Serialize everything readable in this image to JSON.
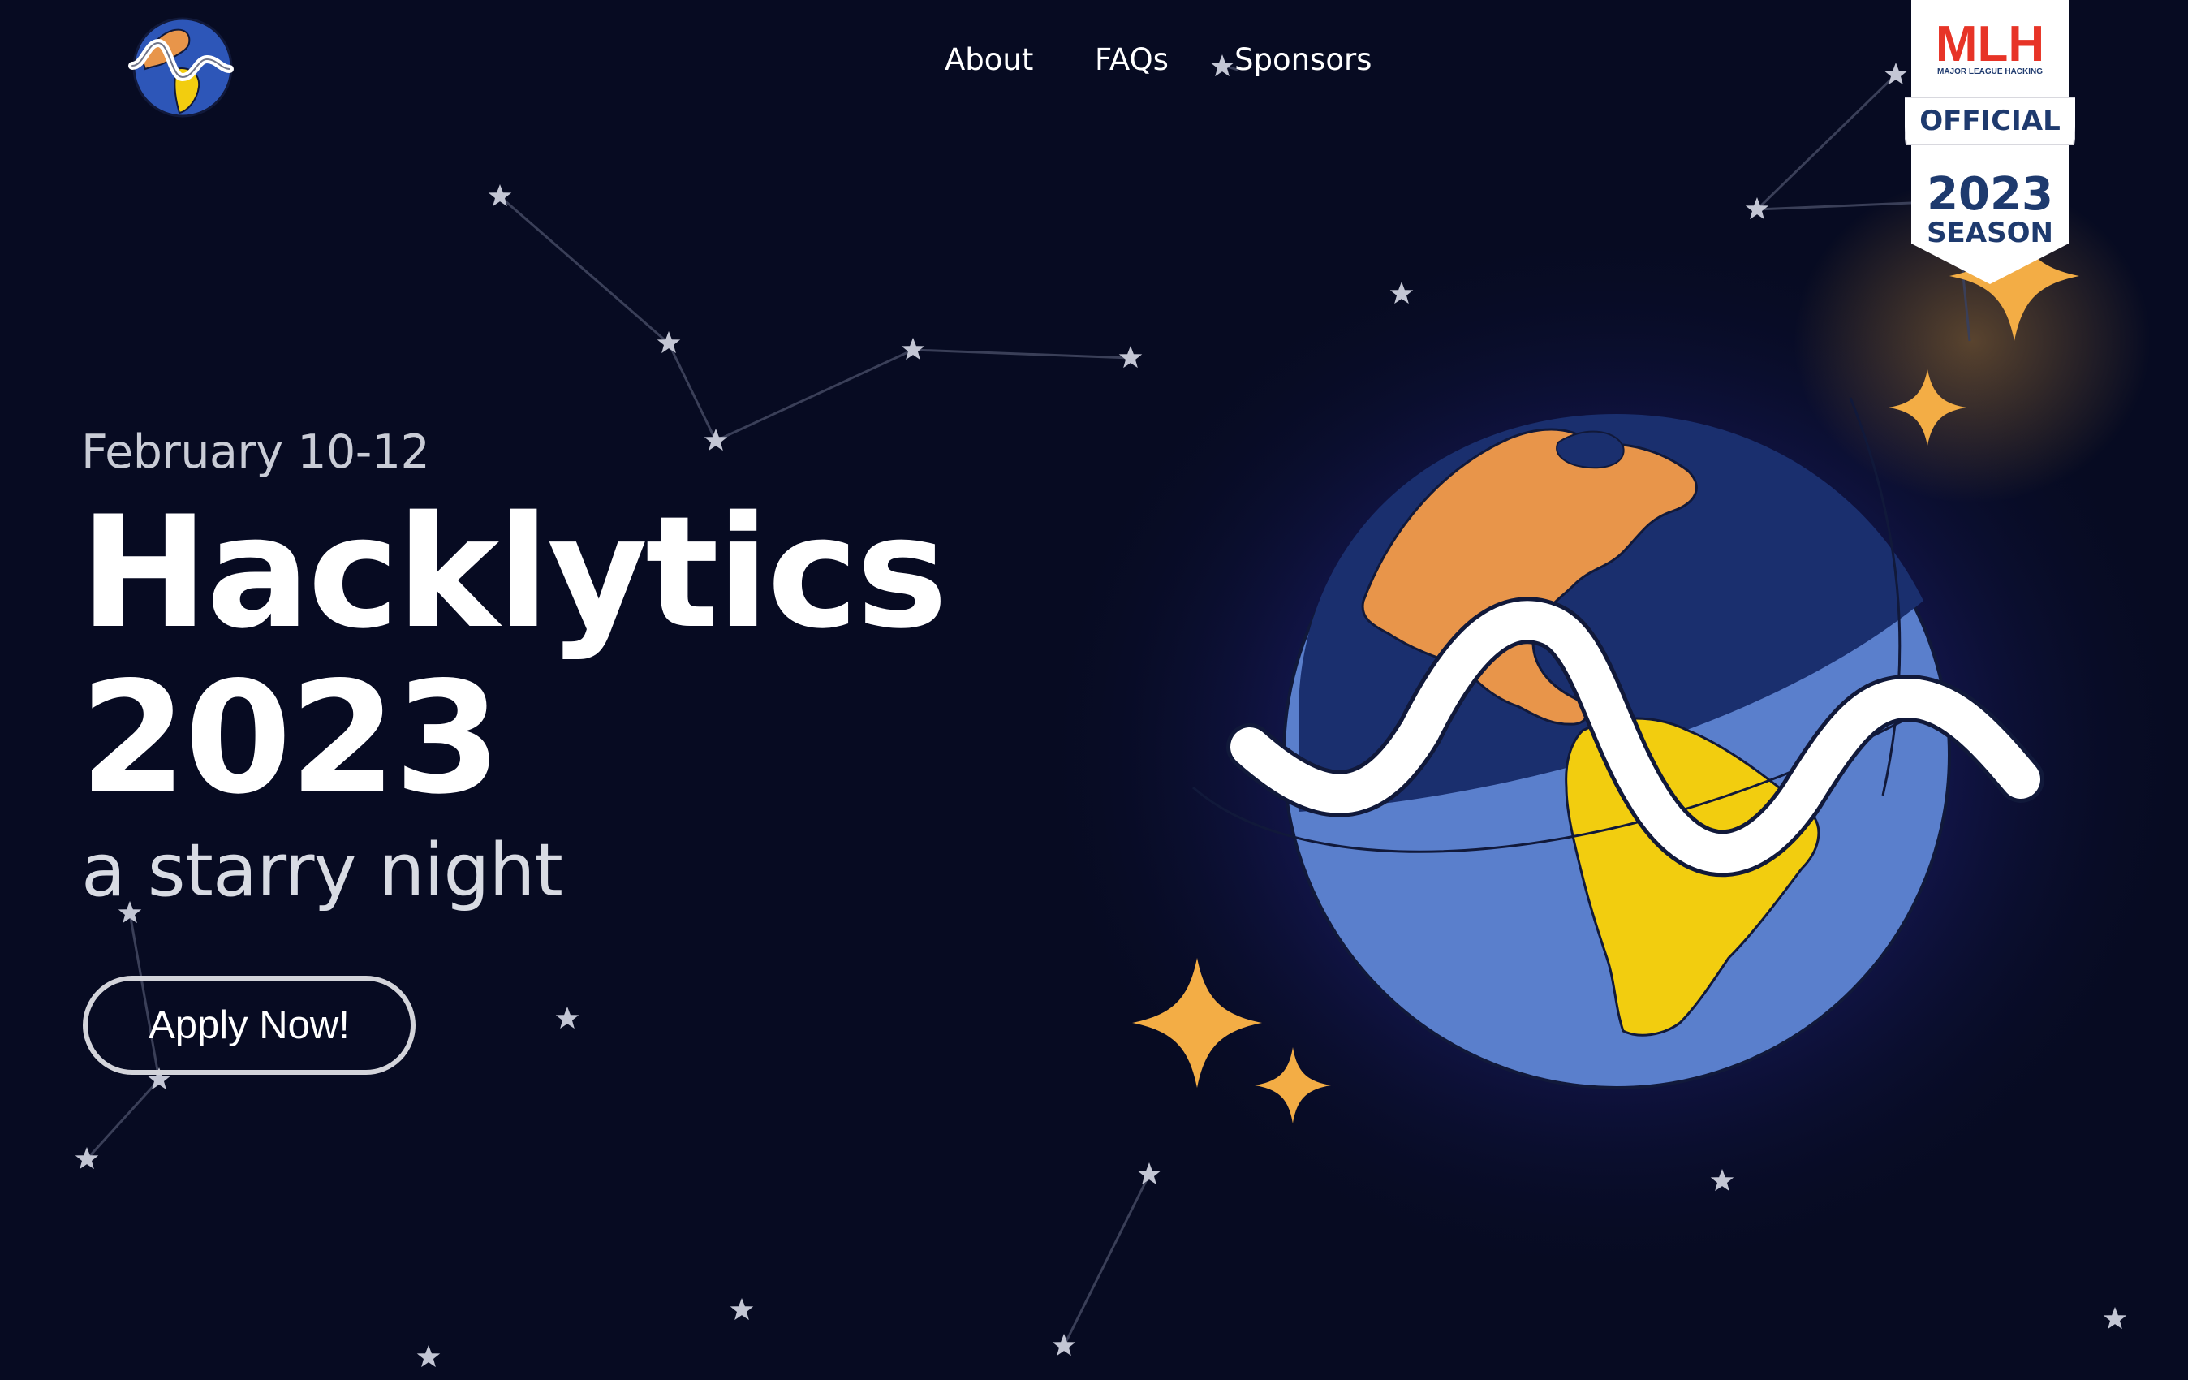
{
  "nav": {
    "about": "About",
    "faqs": "FAQs",
    "sponsors": "Sponsors"
  },
  "hero": {
    "date": "February 10-12",
    "title_line1": "Hacklytics",
    "title_line2": "2023",
    "tagline": "a starry night",
    "apply_label": "Apply Now!"
  },
  "mlh_badge": {
    "brand": "MLH",
    "brand_subtitle": "MAJOR LEAGUE HACKING",
    "official": "OFFICIAL",
    "year": "2023",
    "season": "SEASON"
  },
  "colors": {
    "background": "#070b22",
    "ocean_dark": "#1a2f6e",
    "ocean_light": "#5a7fcc",
    "land_north": "#e8954a",
    "land_south": "#f2cd0f",
    "sparkle": "#f3ad45",
    "star": "#c3c6d4"
  },
  "icons": [
    "star-icon",
    "sparkle-icon",
    "globe-logo-icon",
    "globe-wave-illustration",
    "mlh-badge"
  ]
}
